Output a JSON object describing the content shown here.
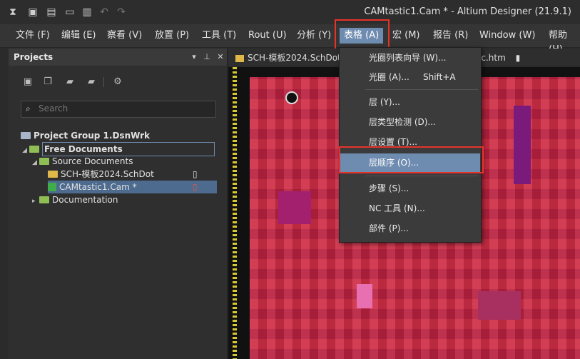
{
  "window": {
    "title": "CAMtastic1.Cam * - Altium Designer (21.9.1)"
  },
  "menubar": [
    {
      "label": "文件 (F)"
    },
    {
      "label": "编辑 (E)"
    },
    {
      "label": "察看 (V)"
    },
    {
      "label": "放置 (P)"
    },
    {
      "label": "工具 (T)"
    },
    {
      "label": "Rout (U)"
    },
    {
      "label": "分析 (Y)"
    },
    {
      "label": "表格 (A)"
    },
    {
      "label": "宏 (M)"
    },
    {
      "label": "报告 (R)"
    },
    {
      "label": "Window (W)"
    },
    {
      "label": "帮助 (H)"
    }
  ],
  "projects_panel": {
    "title": "Projects",
    "search_placeholder": "Search",
    "tree": {
      "group": "Project Group 1.DsnWrk",
      "free_documents": "Free Documents",
      "source_documents": "Source Documents",
      "schdot": "SCH-模板2024.SchDot",
      "cam": "CAMtastic1.Cam *",
      "documentation": "Documentation"
    }
  },
  "tabs": [
    {
      "label": "SCH-模板2024.SchDot"
    },
    {
      "label": "oc.htm"
    }
  ],
  "table_menu": {
    "items": [
      {
        "label": "光圈列表向导 (W)...",
        "shortcut": ""
      },
      {
        "label": "光圈 (A)...",
        "shortcut": "Shift+A"
      },
      {
        "label": "层 (Y)...",
        "shortcut": ""
      },
      {
        "label": "层类型检测 (D)...",
        "shortcut": ""
      },
      {
        "label": "层设置 (T)...",
        "shortcut": ""
      },
      {
        "label": "层顺序 (O)...",
        "shortcut": ""
      },
      {
        "label": "步骤 (S)...",
        "shortcut": ""
      },
      {
        "label": "NC 工具 (N)...",
        "shortcut": ""
      },
      {
        "label": "部件 (P)...",
        "shortcut": ""
      }
    ]
  },
  "colors": {
    "accent": "#6e8bb0",
    "highlight_box": "#e5332a",
    "board": "#c8283c"
  },
  "icons": [
    "app-icon",
    "save-icon",
    "save-all-icon",
    "open-icon",
    "open-doc-icon",
    "undo-icon",
    "redo-icon",
    "search-icon",
    "folder-icon",
    "gear-icon"
  ]
}
